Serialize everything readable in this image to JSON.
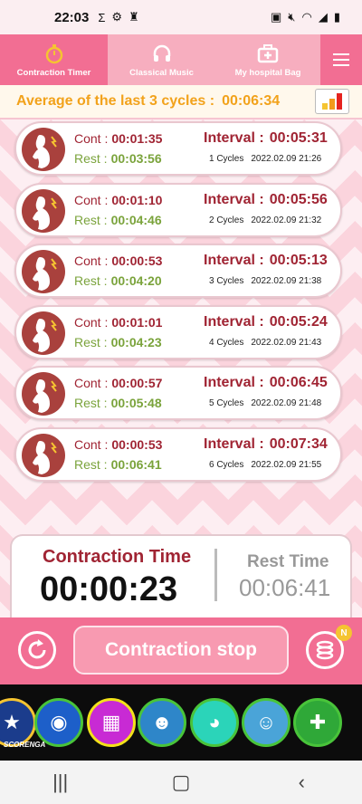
{
  "status": {
    "time": "22:03",
    "left_icons": [
      "sigma-icon",
      "settings-icon",
      "flashlight-icon"
    ],
    "right_icons": [
      "sim-icon",
      "mute-icon",
      "wifi-icon",
      "signal-icon",
      "battery-icon"
    ]
  },
  "tabs": [
    {
      "label": "Contraction Timer",
      "icon": "stopwatch-icon",
      "active": true
    },
    {
      "label": "Classical Music",
      "icon": "headphones-icon",
      "active": false
    },
    {
      "label": "My hospital Bag",
      "icon": "medical-bag-icon",
      "active": false
    }
  ],
  "average": {
    "label": "Average of the last 3 cycles :",
    "value": "00:06:34"
  },
  "cards_labels": {
    "cont": "Cont :",
    "rest": "Rest :",
    "interval": "Interval :"
  },
  "cycles": [
    {
      "cont": "00:01:35",
      "rest": "00:03:56",
      "interval": "00:05:31",
      "cycle": "1 Cycles",
      "datetime": "2022.02.09 21:26"
    },
    {
      "cont": "00:01:10",
      "rest": "00:04:46",
      "interval": "00:05:56",
      "cycle": "2 Cycles",
      "datetime": "2022.02.09 21:32"
    },
    {
      "cont": "00:00:53",
      "rest": "00:04:20",
      "interval": "00:05:13",
      "cycle": "3 Cycles",
      "datetime": "2022.02.09 21:38"
    },
    {
      "cont": "00:01:01",
      "rest": "00:04:23",
      "interval": "00:05:24",
      "cycle": "4 Cycles",
      "datetime": "2022.02.09 21:43"
    },
    {
      "cont": "00:00:57",
      "rest": "00:05:48",
      "interval": "00:06:45",
      "cycle": "5 Cycles",
      "datetime": "2022.02.09 21:48"
    },
    {
      "cont": "00:00:53",
      "rest": "00:06:41",
      "interval": "00:07:34",
      "cycle": "6 Cycles",
      "datetime": "2022.02.09 21:55"
    }
  ],
  "timer": {
    "contraction_label": "Contraction Time",
    "contraction_value": "00:00:23",
    "rest_label": "Rest Time",
    "rest_value": "00:06:41"
  },
  "controls": {
    "stop_label": "Contraction stop",
    "badge": "N"
  },
  "ad": {
    "logo_text": "SCORENGA",
    "games": [
      "sonic-icon",
      "spongebob-icon",
      "subway-surfer-icon",
      "jake-icon",
      "talking-tom-icon",
      "mario-icon"
    ]
  },
  "colors": {
    "accent": "#f26e93",
    "cont": "#a02433",
    "rest": "#7aa33b",
    "average": "#f2a21b"
  }
}
